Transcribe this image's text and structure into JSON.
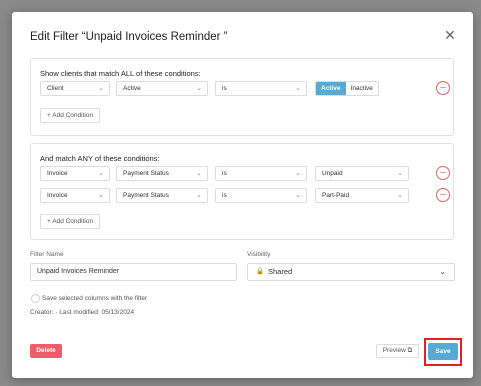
{
  "dialog": {
    "title": "Edit Filter “Unpaid Invoices Reminder ”",
    "close_glyph": "✕"
  },
  "all_conditions": {
    "title": "Show clients that match ALL of these conditions:",
    "rows": [
      {
        "entity": "Client",
        "field": "Active",
        "operator": "is",
        "toggle_on": "Active",
        "toggle_off": "Inactive"
      }
    ],
    "add_label": "+ Add Condition"
  },
  "any_conditions": {
    "title": "And match ANY of these conditions:",
    "rows": [
      {
        "entity": "Invoice",
        "field": "Payment Status",
        "operator": "is",
        "value": "Unpaid"
      },
      {
        "entity": "Invoice",
        "field": "Payment Status",
        "operator": "is",
        "value": "Part-Paid"
      }
    ],
    "add_label": "+ Add Condition"
  },
  "filter_name": {
    "label": "Filter Name",
    "value": "Unpaid Invoices Reminder"
  },
  "visibility": {
    "label": "Visibility",
    "value": "Shared",
    "lock_glyph": "🔒"
  },
  "save_columns": {
    "label": "Save selected columns with the filter"
  },
  "meta": {
    "text": "Creator:  ·  Last modified: 05/13/2024"
  },
  "footer": {
    "delete_label": "Delete",
    "preview_label": "Preview ⧉",
    "save_label": "Save"
  },
  "colors": {
    "accent": "#56aad3",
    "danger": "#ef5d6b",
    "highlight": "#dd2222"
  },
  "icons": {
    "chevron": "⌄",
    "minus": "–"
  }
}
